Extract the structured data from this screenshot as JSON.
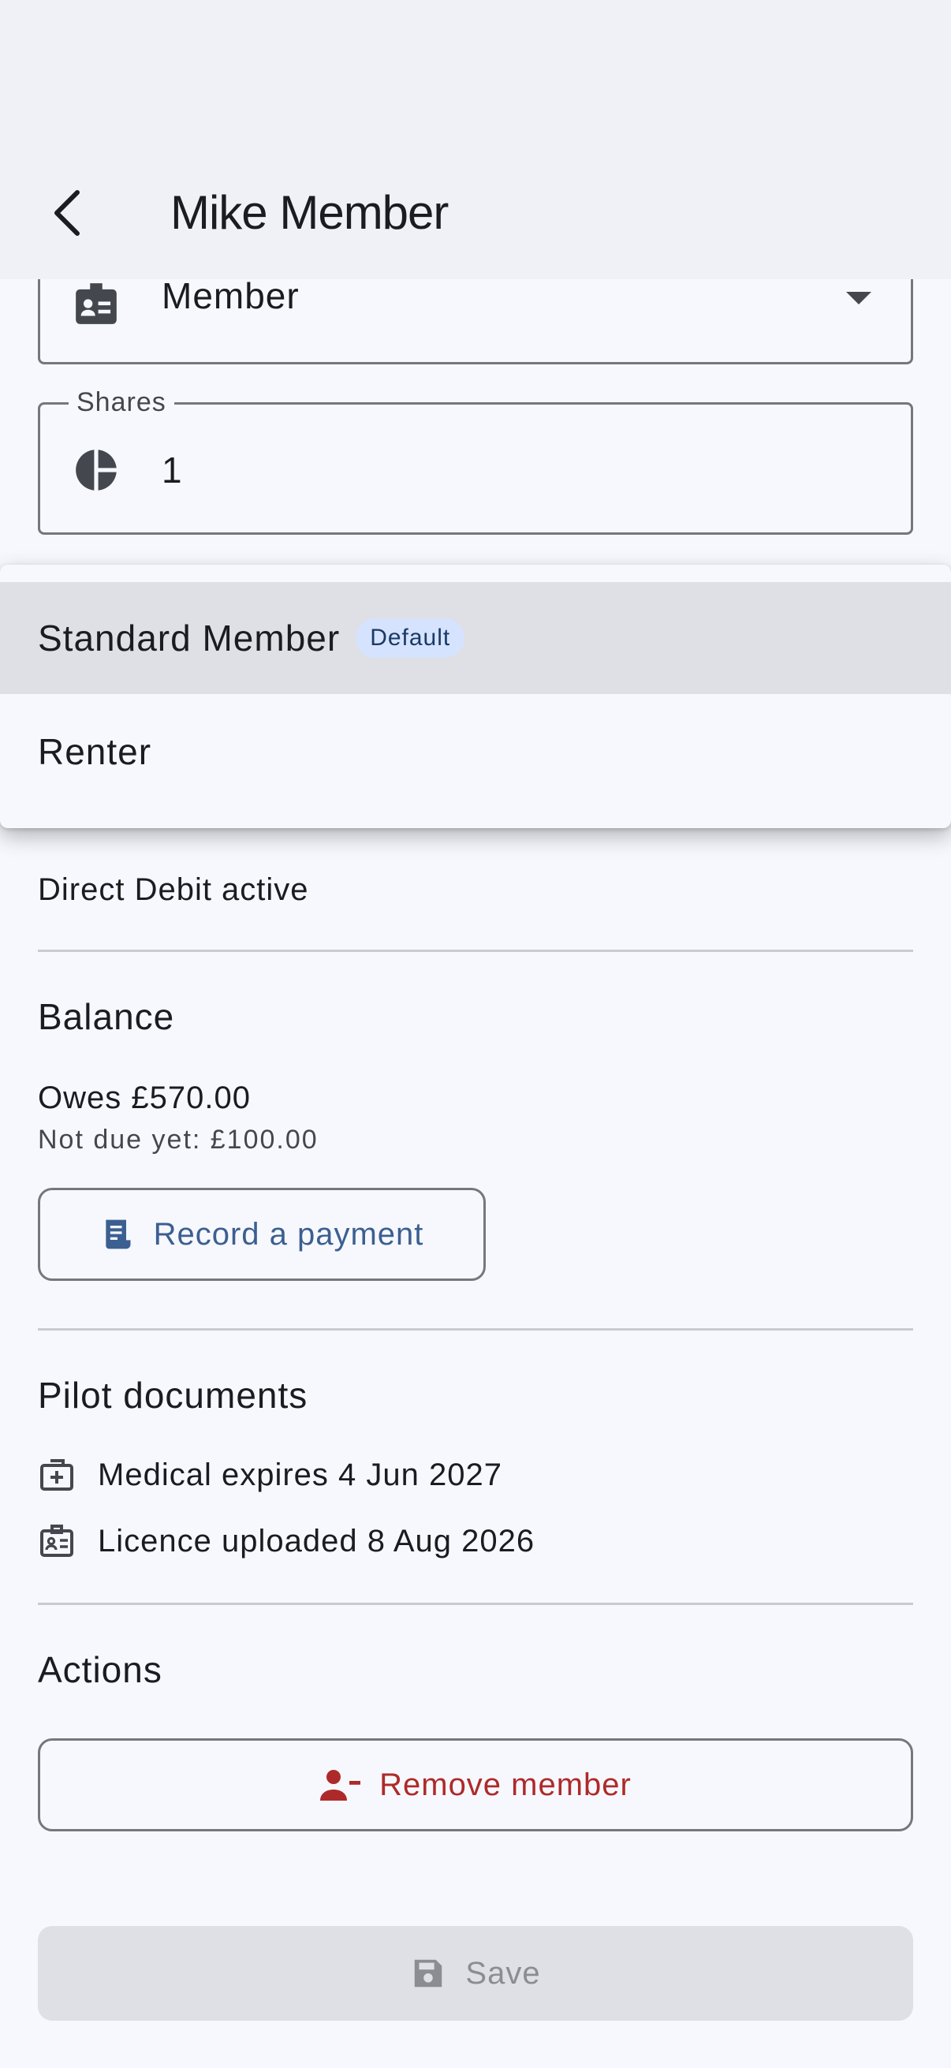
{
  "appbar": {
    "title": "Mike Member"
  },
  "form": {
    "role": {
      "value": "Member"
    },
    "shares": {
      "label": "Shares",
      "value": "1"
    }
  },
  "menu": {
    "items": [
      {
        "label": "Standard Member",
        "badge": "Default"
      },
      {
        "label": "Renter"
      }
    ]
  },
  "payment": {
    "status": "Direct Debit active"
  },
  "balance": {
    "title": "Balance",
    "owes": "Owes £570.00",
    "not_due": "Not due yet: £100.00",
    "record_label": "Record a payment"
  },
  "pilot_documents": {
    "title": "Pilot documents",
    "medical": "Medical expires 4 Jun 2027",
    "licence": "Licence uploaded 8 Aug 2026"
  },
  "actions": {
    "title": "Actions",
    "remove_label": "Remove member"
  },
  "save": {
    "label": "Save"
  },
  "colors": {
    "accent": "#3c5f91",
    "danger": "#ae2a2a",
    "badge_bg": "#d6e3ff"
  }
}
